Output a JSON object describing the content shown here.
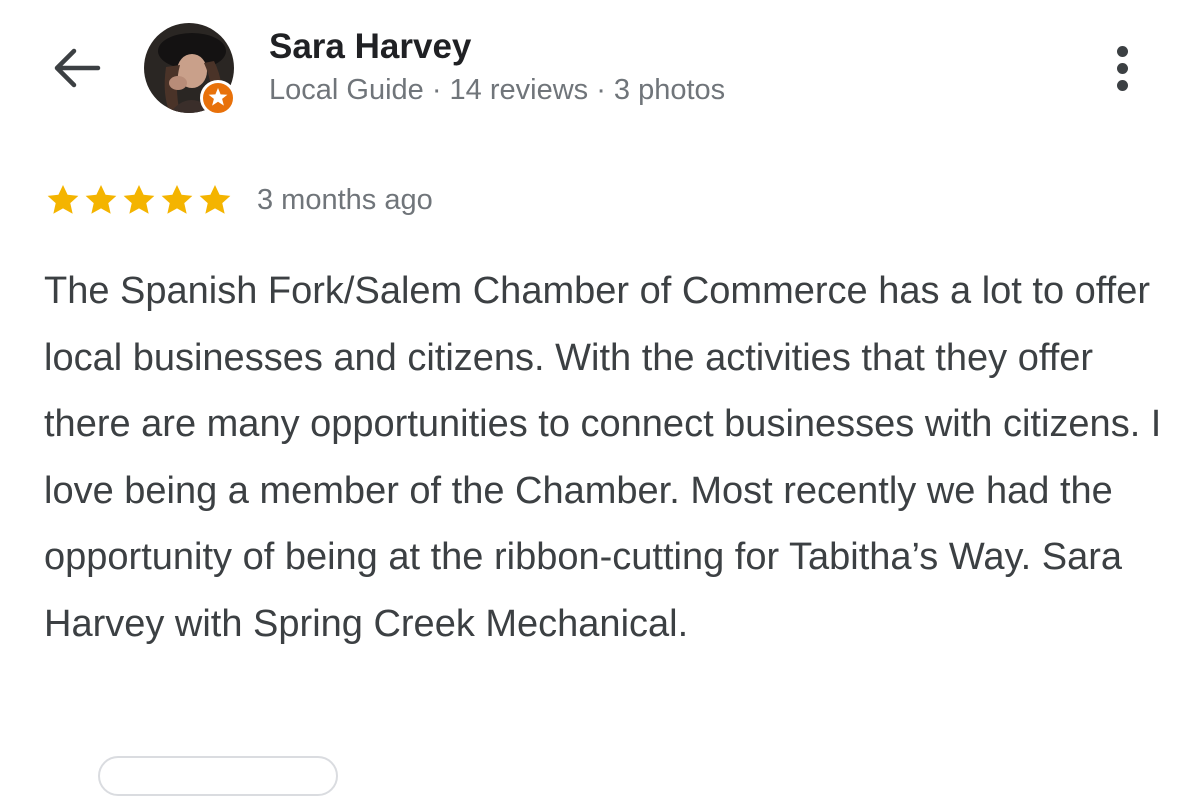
{
  "reviewer": {
    "name": "Sara Harvey",
    "meta": "Local Guide · 14 reviews · 3 photos"
  },
  "review": {
    "rating": 5,
    "rating_max": 5,
    "date": "3 months ago",
    "text": "The Spanish Fork/Salem Chamber of Commerce has a lot to offer local businesses and citizens. With the activities that they offer there are many opportunities to connect businesses with citizens. I love being a member of the Chamber. Most recently we had the opportunity of being at the ribbon-cutting for Tabitha’s Way. Sara Harvey with Spring Creek Mechanical."
  },
  "icons": {
    "back": "arrow-back-icon",
    "more": "more-vertical-icon",
    "star": "star-icon",
    "badge": "local-guide-badge-icon"
  },
  "colors": {
    "star": "#f4b400",
    "badge": "#e8710a",
    "name": "#202124",
    "meta": "#70757a",
    "body_text": "#3c4043"
  }
}
